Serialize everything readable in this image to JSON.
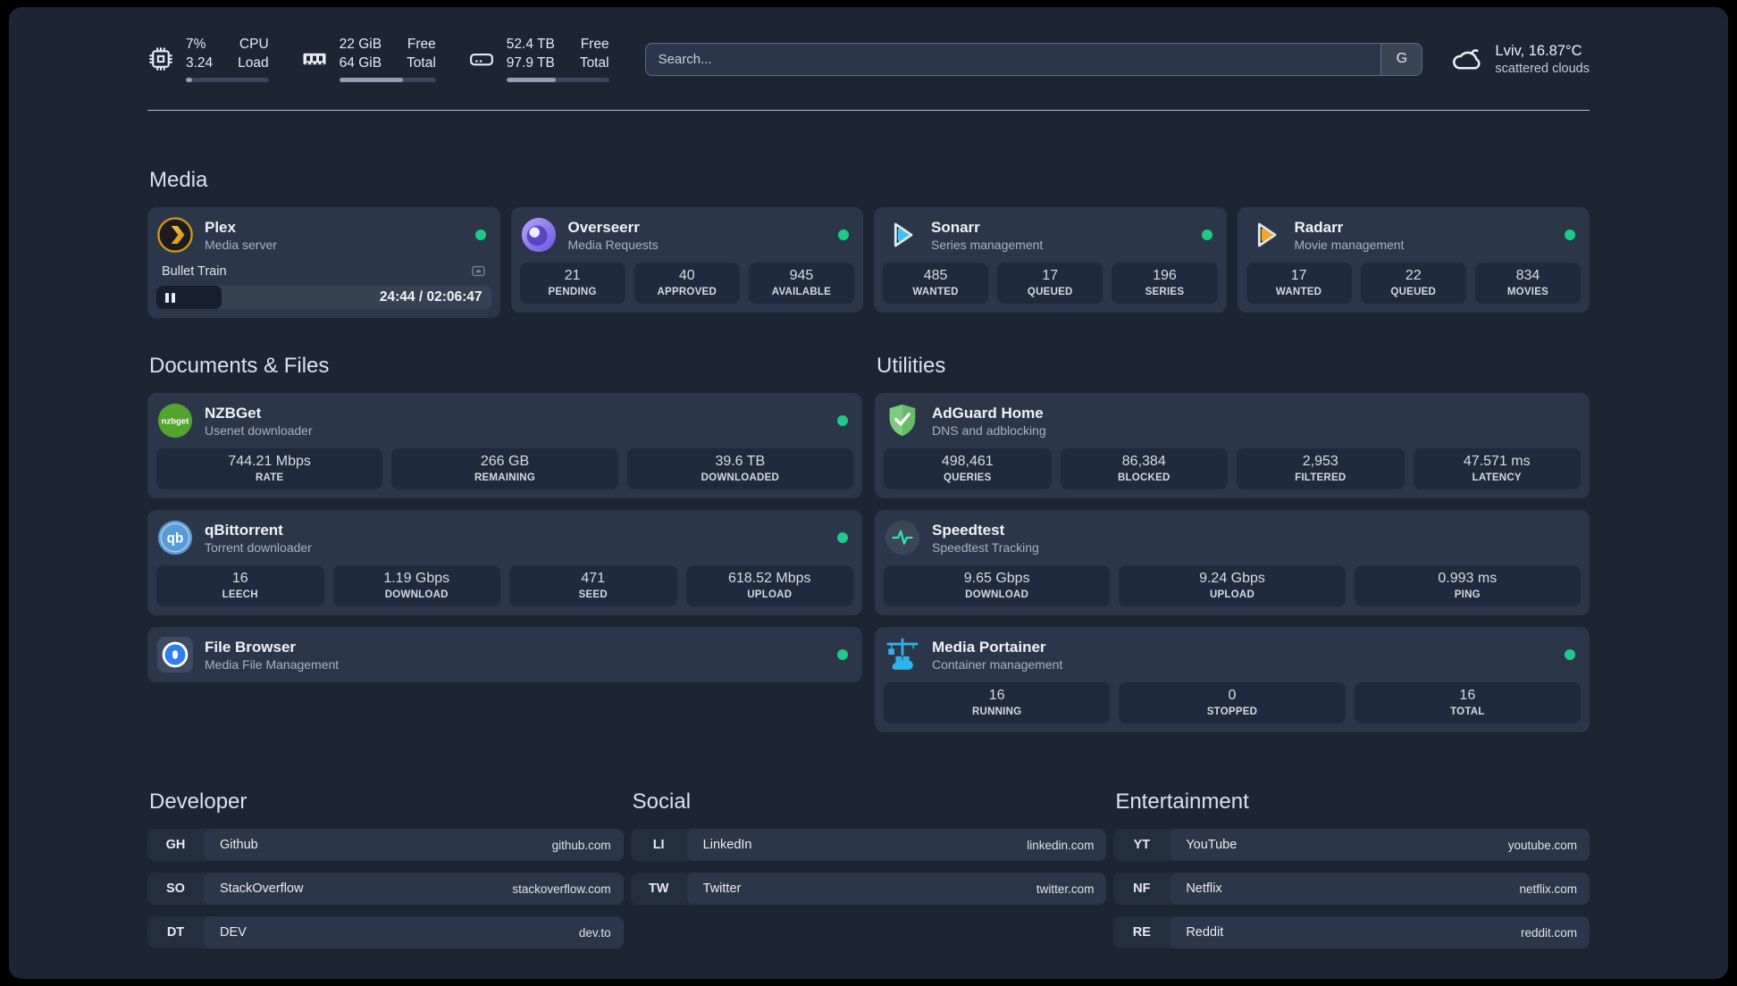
{
  "topbar": {
    "cpu": {
      "value_top": "7%",
      "value_bottom": "3.24",
      "label_top": "CPU",
      "label_bottom": "Load",
      "progress": 8
    },
    "memory": {
      "value_top": "22 GiB",
      "value_bottom": "64 GiB",
      "label_top": "Free",
      "label_bottom": "Total",
      "progress": 66
    },
    "disk": {
      "value_top": "52.4 TB",
      "value_bottom": "97.9 TB",
      "label_top": "Free",
      "label_bottom": "Total",
      "progress": 48
    },
    "search": {
      "placeholder": "Search...",
      "provider": "G"
    },
    "weather": {
      "location": "Lviv, 16.87°C",
      "condition": "scattered clouds"
    }
  },
  "icons": {
    "cpu-icon": "cpu chip outline",
    "memory-icon": "ram stick",
    "disk-icon": "hard drive outline",
    "search-provider": "letter G",
    "cloud-icon": "cloud outline",
    "pause-icon": "two vertical bars",
    "cast-icon": "display glyph",
    "status-dot": "green circle"
  },
  "colors": {
    "status_online": "#1ec98a",
    "background": "#1b2534",
    "card": "#2b3748",
    "stat_block": "#1f2b3c"
  },
  "sections": {
    "media": {
      "title": "Media",
      "plex": {
        "name": "Plex",
        "desc": "Media server",
        "player": {
          "title": "Bullet Train",
          "time": "24:44 / 02:06:47",
          "progress": 19.5
        }
      },
      "overseerr": {
        "name": "Overseerr",
        "desc": "Media Requests",
        "stats": [
          {
            "value": "21",
            "label": "PENDING"
          },
          {
            "value": "40",
            "label": "APPROVED"
          },
          {
            "value": "945",
            "label": "AVAILABLE"
          }
        ]
      },
      "sonarr": {
        "name": "Sonarr",
        "desc": "Series management",
        "stats": [
          {
            "value": "485",
            "label": "WANTED"
          },
          {
            "value": "17",
            "label": "QUEUED"
          },
          {
            "value": "196",
            "label": "SERIES"
          }
        ]
      },
      "radarr": {
        "name": "Radarr",
        "desc": "Movie management",
        "stats": [
          {
            "value": "17",
            "label": "WANTED"
          },
          {
            "value": "22",
            "label": "QUEUED"
          },
          {
            "value": "834",
            "label": "MOVIES"
          }
        ]
      }
    },
    "documents": {
      "title": "Documents & Files",
      "nzbget": {
        "name": "NZBGet",
        "desc": "Usenet downloader",
        "stats": [
          {
            "value": "744.21 Mbps",
            "label": "RATE"
          },
          {
            "value": "266 GB",
            "label": "REMAINING"
          },
          {
            "value": "39.6 TB",
            "label": "DOWNLOADED"
          }
        ]
      },
      "qbittorrent": {
        "name": "qBittorrent",
        "desc": "Torrent downloader",
        "stats": [
          {
            "value": "16",
            "label": "LEECH"
          },
          {
            "value": "1.19 Gbps",
            "label": "DOWNLOAD"
          },
          {
            "value": "471",
            "label": "SEED"
          },
          {
            "value": "618.52 Mbps",
            "label": "UPLOAD"
          }
        ]
      },
      "filebrowser": {
        "name": "File Browser",
        "desc": "Media File Management"
      }
    },
    "utilities": {
      "title": "Utilities",
      "adguard": {
        "name": "AdGuard Home",
        "desc": "DNS and adblocking",
        "stats": [
          {
            "value": "498,461",
            "label": "QUERIES"
          },
          {
            "value": "86,384",
            "label": "BLOCKED"
          },
          {
            "value": "2,953",
            "label": "FILTERED"
          },
          {
            "value": "47.571 ms",
            "label": "LATENCY"
          }
        ]
      },
      "speedtest": {
        "name": "Speedtest",
        "desc": "Speedtest Tracking",
        "stats": [
          {
            "value": "9.65 Gbps",
            "label": "DOWNLOAD"
          },
          {
            "value": "9.24 Gbps",
            "label": "UPLOAD"
          },
          {
            "value": "0.993 ms",
            "label": "PING"
          }
        ]
      },
      "portainer": {
        "name": "Media Portainer",
        "desc": "Container management",
        "stats": [
          {
            "value": "16",
            "label": "RUNNING"
          },
          {
            "value": "0",
            "label": "STOPPED"
          },
          {
            "value": "16",
            "label": "TOTAL"
          }
        ]
      }
    }
  },
  "bookmarks": [
    {
      "title": "Developer",
      "items": [
        {
          "abbr": "GH",
          "name": "Github",
          "domain": "github.com"
        },
        {
          "abbr": "SO",
          "name": "StackOverflow",
          "domain": "stackoverflow.com"
        },
        {
          "abbr": "DT",
          "name": "DEV",
          "domain": "dev.to"
        }
      ]
    },
    {
      "title": "Social",
      "items": [
        {
          "abbr": "LI",
          "name": "LinkedIn",
          "domain": "linkedin.com"
        },
        {
          "abbr": "TW",
          "name": "Twitter",
          "domain": "twitter.com"
        }
      ]
    },
    {
      "title": "Entertainment",
      "items": [
        {
          "abbr": "YT",
          "name": "YouTube",
          "domain": "youtube.com"
        },
        {
          "abbr": "NF",
          "name": "Netflix",
          "domain": "netflix.com"
        },
        {
          "abbr": "RE",
          "name": "Reddit",
          "domain": "reddit.com"
        }
      ]
    }
  ]
}
